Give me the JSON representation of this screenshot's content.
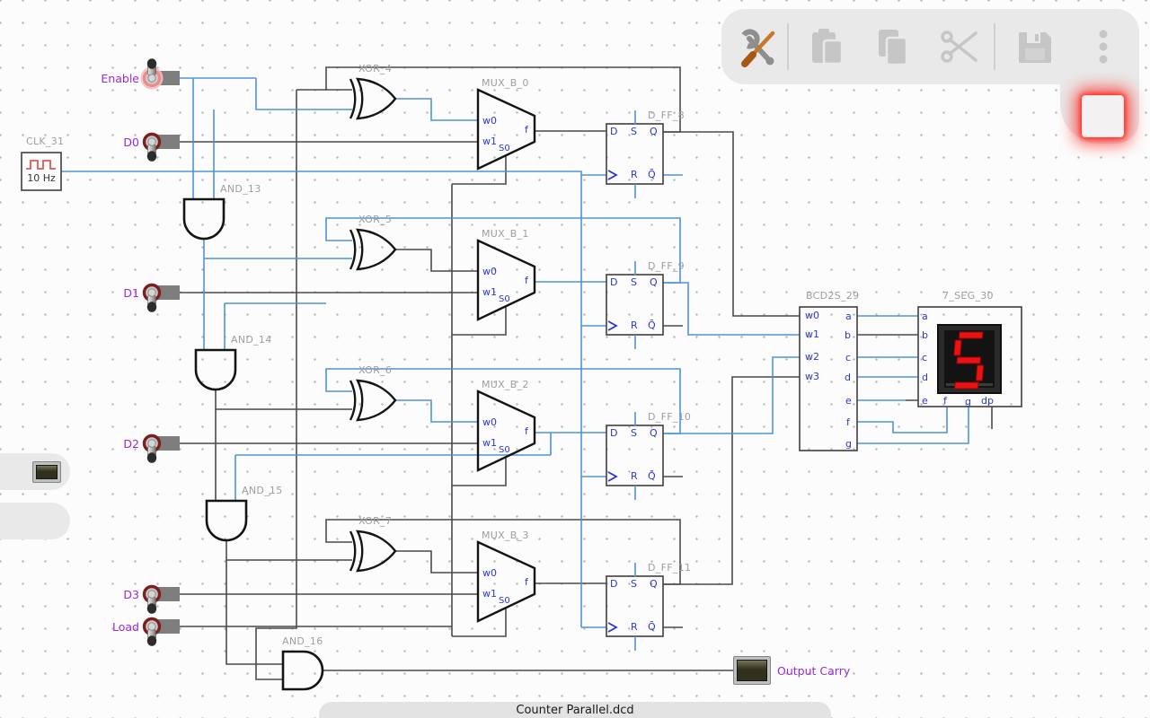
{
  "app": {
    "file_name": "Counter Parallel.dcd"
  },
  "toolbar": {
    "icons": [
      "tools-icon",
      "paste-icon",
      "copy-icon",
      "cut-icon",
      "save-icon",
      "more-icon"
    ],
    "stop_button": "stop"
  },
  "palette": {
    "items": [
      "led",
      "toggle-switch"
    ]
  },
  "inputs": {
    "enable": "Enable",
    "d0": "D0",
    "d1": "D1",
    "d2": "D2",
    "d3": "D3",
    "load": "Load"
  },
  "outputs": {
    "carry": "Output Carry"
  },
  "clock": {
    "label": "CLK_31",
    "frequency": "10 Hz"
  },
  "gates": {
    "and13": "AND_13",
    "and14": "AND_14",
    "and15": "AND_15",
    "and16": "AND_16",
    "xor4": "XOR_4",
    "xor5": "XOR_5",
    "xor6": "XOR_6",
    "xor7": "XOR_7"
  },
  "muxes": {
    "m0": "MUX_B_0",
    "m1": "MUX_B_1",
    "m2": "MUX_B_2",
    "m3": "MUX_B_3"
  },
  "flipflops": {
    "f8": "D_FF_8",
    "f9": "D_FF_9",
    "f10": "D_FF_10",
    "f11": "D_FF_11"
  },
  "decoder": {
    "label": "BCD2S_29"
  },
  "display": {
    "label": "7_SEG_30",
    "value": "5"
  },
  "pins": {
    "mux": {
      "w0": "w0",
      "w1": "w1",
      "s0": "S0",
      "f": "f"
    },
    "ff": {
      "d": "D",
      "s": "S",
      "q": "Q",
      "r": "R",
      "qbar": "Q̄"
    },
    "bcd": {
      "w0": "w0",
      "w1": "w1",
      "w2": "w2",
      "w3": "w3",
      "a": "a",
      "b": "b",
      "c": "c",
      "d": "d",
      "e": "e",
      "f": "f",
      "g": "g"
    },
    "seg": {
      "a": "a",
      "b": "b",
      "c": "c",
      "d": "d",
      "e": "e",
      "f": "f",
      "g": "g",
      "dp": "dp"
    }
  },
  "colors": {
    "wire_high": "#4d94db",
    "wire_low": "#4a4a4a",
    "label": "#9e9e9e",
    "pin_text": "#2b36cf",
    "io_label": "#9a2ad0",
    "segment_on": "#ed1212"
  }
}
